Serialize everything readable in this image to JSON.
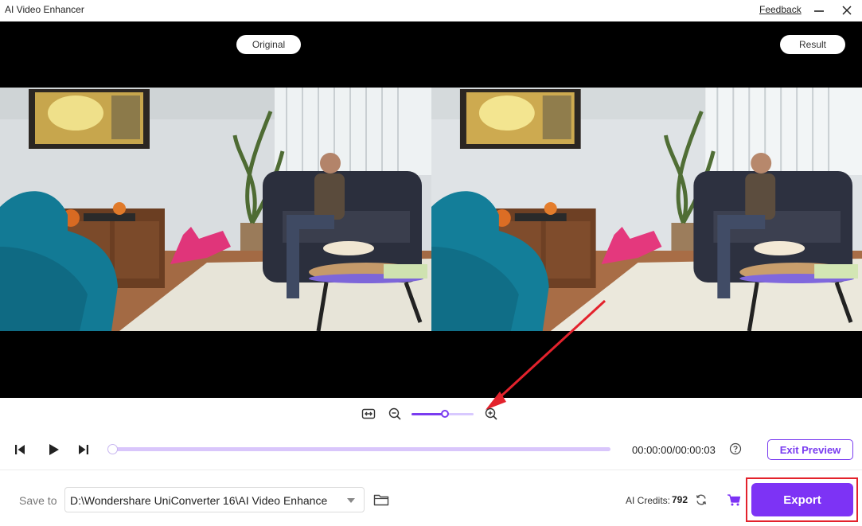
{
  "window": {
    "title": "AI Video Enhancer",
    "feedback_label": "Feedback",
    "icons": [
      "minimize-icon",
      "close-icon"
    ]
  },
  "preview": {
    "original_label": "Original",
    "result_label": "Result",
    "background": "#000000"
  },
  "zoom": {
    "icons": [
      "fit-width-icon",
      "zoom-out-icon",
      "zoom-in-icon"
    ],
    "level": 0.54
  },
  "playback": {
    "icons": [
      "previous-frame-icon",
      "play-icon",
      "next-frame-icon",
      "help-icon"
    ],
    "progress": 0,
    "timecode": "00:00:00/00:00:03",
    "exit_preview_label": "Exit Preview"
  },
  "footer": {
    "save_to_label": "Save to",
    "save_path": "D:\\Wondershare UniConverter 16\\AI Video Enhance",
    "credits_label": "AI Credits:",
    "credits_value": "792",
    "export_label": "Export",
    "icons": [
      "folder-icon",
      "refresh-icon",
      "cart-icon"
    ]
  },
  "colors": {
    "accent": "#7d33f5",
    "accent_light": "#d9c6fb",
    "highlight_outline": "#e3222c"
  }
}
